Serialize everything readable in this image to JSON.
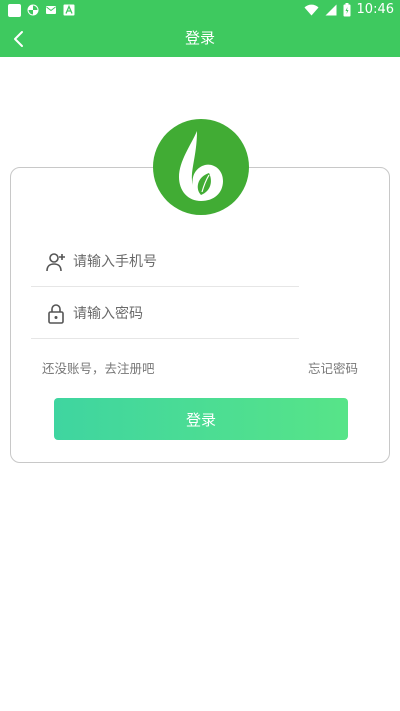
{
  "status_bar": {
    "time": "10:46",
    "left_icons": [
      "square-icon",
      "pinwheel-icon",
      "mail-icon",
      "font-a-icon"
    ],
    "right_icons": [
      "wifi-icon",
      "signal-icon",
      "battery-icon"
    ]
  },
  "header": {
    "title": "登录",
    "back_icon": "chevron-left-icon"
  },
  "logo": {
    "icon": "leaf-drop-logo"
  },
  "form": {
    "phone": {
      "icon": "user-add-icon",
      "placeholder": "请输入手机号",
      "value": ""
    },
    "password": {
      "icon": "lock-icon",
      "placeholder": "请输入密码",
      "value": ""
    },
    "register_link": "还没账号，去注册吧",
    "forgot_link": "忘记密码",
    "login_button": "登录"
  },
  "colors": {
    "primary": "#3ec95f",
    "logo_bg": "#41ac34",
    "button_gradient_start": "#3fd5a0",
    "button_gradient_end": "#57e488",
    "card_border": "#c8c8c8",
    "link_text": "#777777"
  }
}
